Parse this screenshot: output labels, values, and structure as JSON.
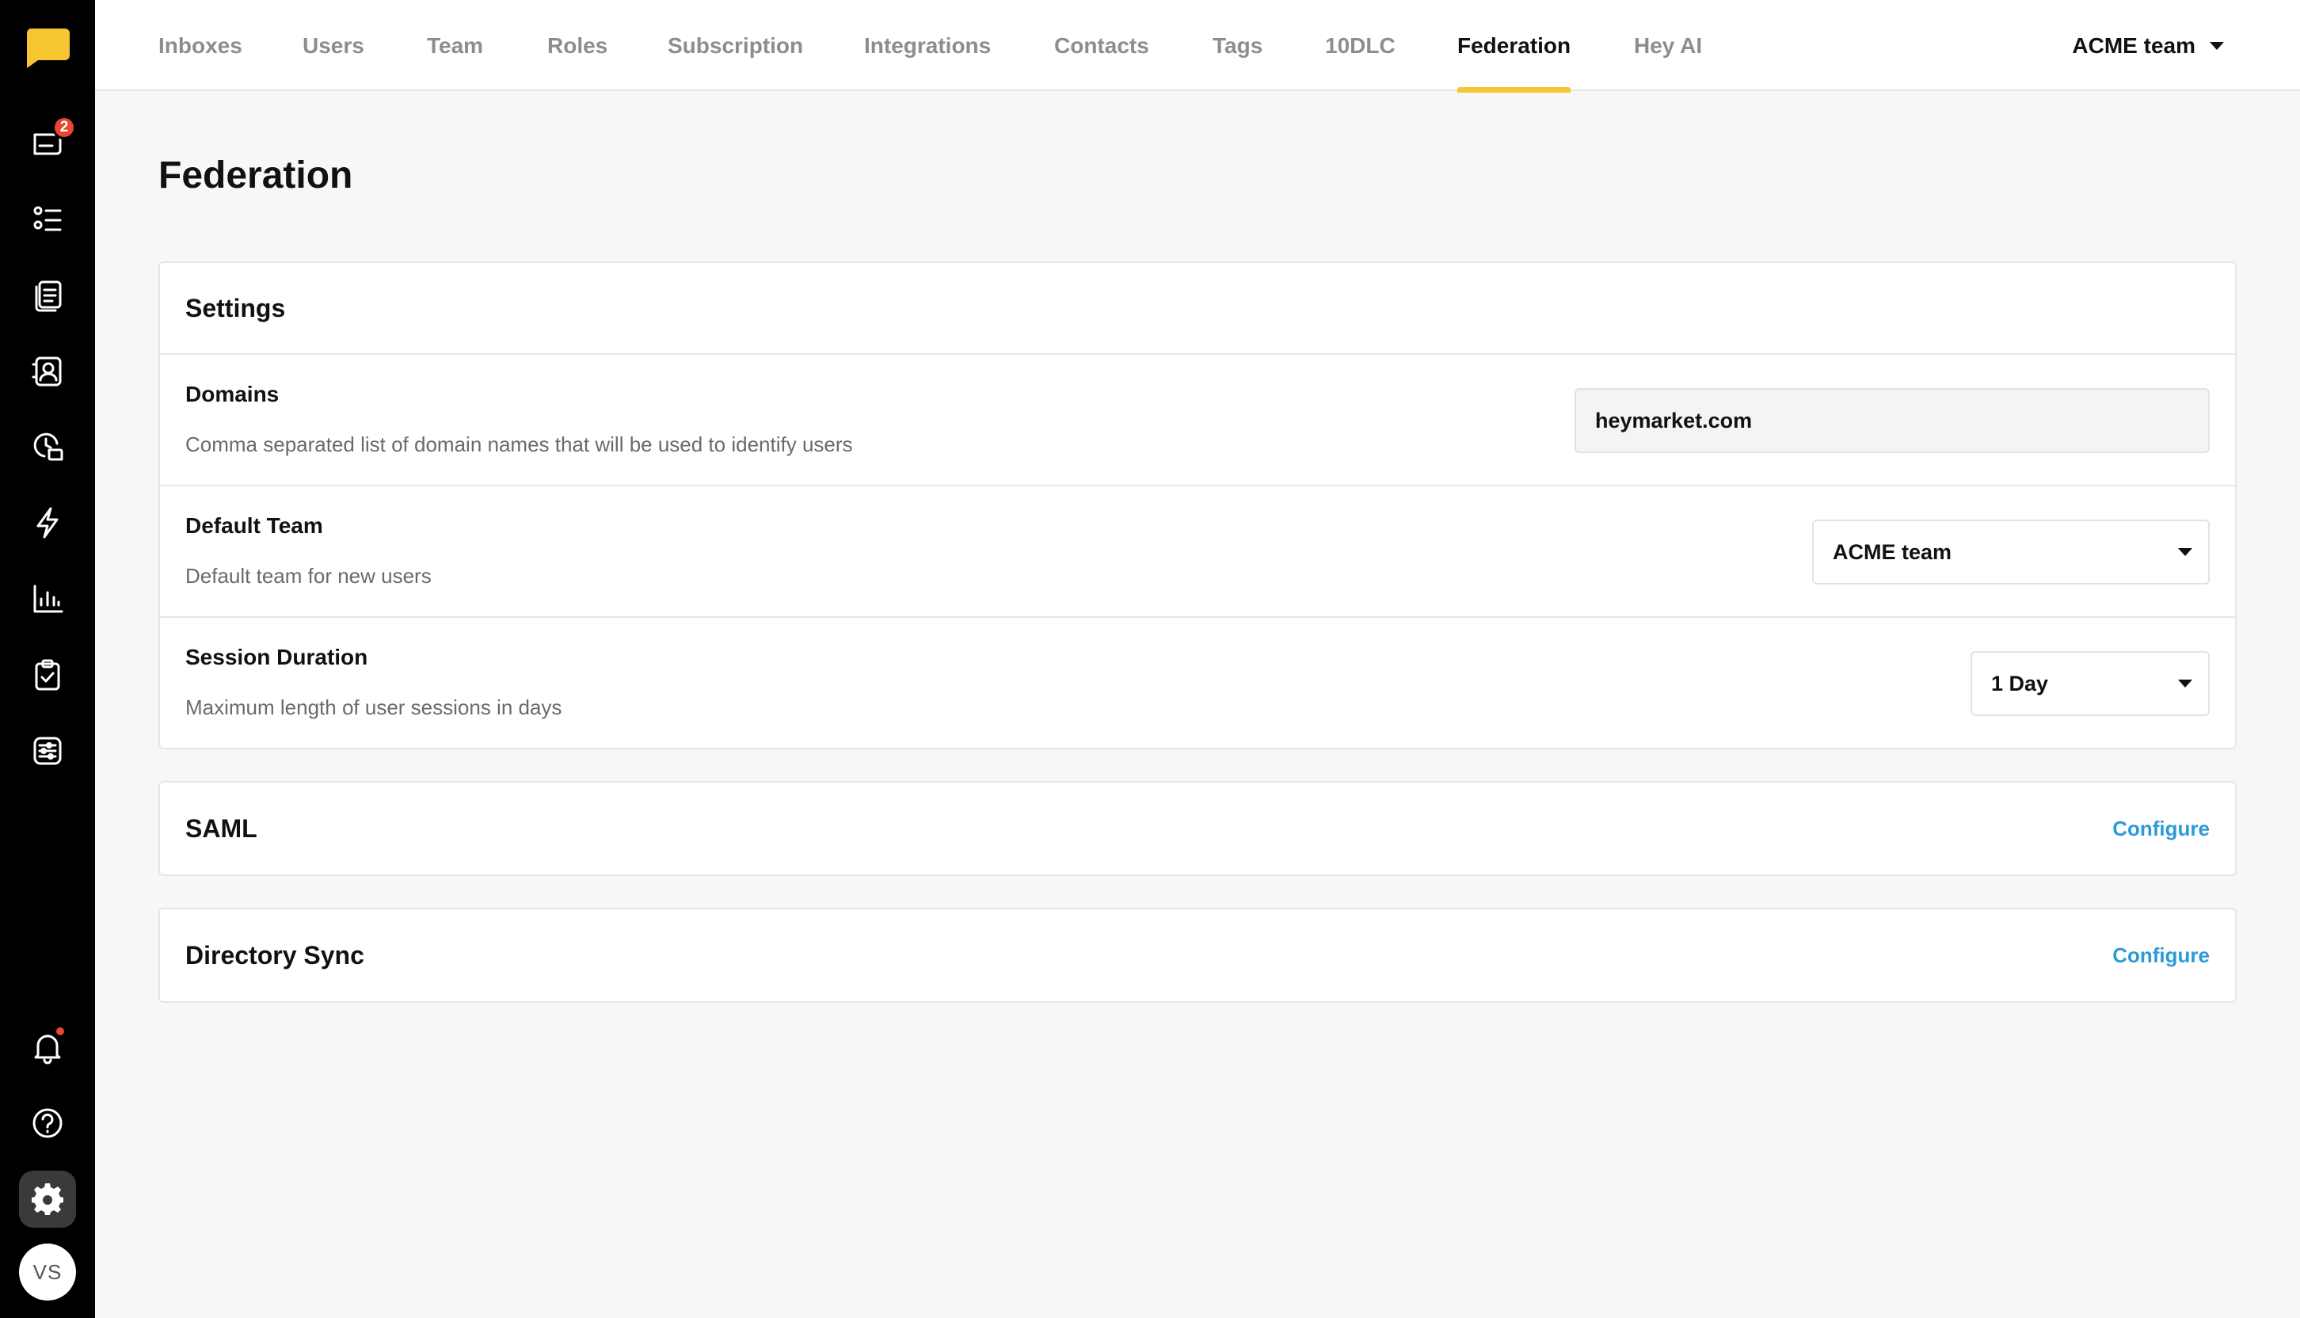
{
  "nav": {
    "tabs": [
      {
        "label": "Inboxes"
      },
      {
        "label": "Users"
      },
      {
        "label": "Team"
      },
      {
        "label": "Roles"
      },
      {
        "label": "Subscription"
      },
      {
        "label": "Integrations"
      },
      {
        "label": "Contacts"
      },
      {
        "label": "Tags"
      },
      {
        "label": "10DLC"
      },
      {
        "label": "Federation",
        "active": true
      },
      {
        "label": "Hey AI"
      }
    ],
    "team_selector": "ACME team"
  },
  "sidebar": {
    "inbox_badge": "2",
    "avatar_initials": "VS",
    "icons": [
      "logo-chat-icon",
      "inbox-chat-icon",
      "list-icon",
      "documents-icon",
      "contacts-icon",
      "history-chat-icon",
      "lightning-icon",
      "bar-chart-icon",
      "clipboard-check-icon",
      "sliders-icon",
      "bell-icon",
      "help-icon",
      "gear-icon"
    ],
    "accent_color": "#f7c531",
    "badge_color": "#e8462e"
  },
  "page": {
    "title": "Federation"
  },
  "settings": {
    "title": "Settings",
    "domains": {
      "label": "Domains",
      "description": "Comma separated list of domain names that will be used to identify users",
      "value": "heymarket.com"
    },
    "default_team": {
      "label": "Default Team",
      "description": "Default team for new users",
      "value": "ACME team"
    },
    "session_duration": {
      "label": "Session Duration",
      "description": "Maximum length of user sessions in days",
      "value": "1 Day"
    }
  },
  "saml": {
    "title": "SAML",
    "action": "Configure"
  },
  "directory_sync": {
    "title": "Directory Sync",
    "action": "Configure"
  },
  "colors": {
    "link": "#2b9bd8",
    "active_tab_underline": "#f7c531"
  }
}
